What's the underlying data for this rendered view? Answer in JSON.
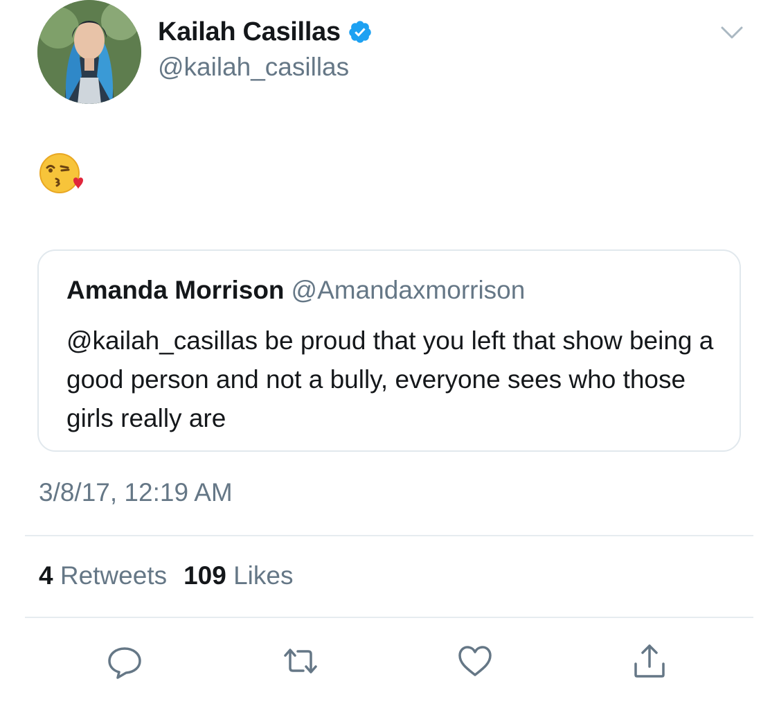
{
  "author": {
    "display_name": "Kailah Casillas",
    "handle": "@kailah_casillas",
    "verified": true
  },
  "tweet": {
    "emoji": "kissing-face-with-heart",
    "timestamp": "3/8/17, 12:19 AM"
  },
  "quoted_tweet": {
    "display_name": "Amanda Morrison",
    "handle": "@Amandaxmorrison",
    "text": "@kailah_casillas be proud that you left that show being a good person and not a bully, everyone sees who those girls really are"
  },
  "stats": {
    "retweets_count": "4",
    "retweets_label": "Retweets",
    "likes_count": "109",
    "likes_label": "Likes"
  },
  "actions": [
    "reply-icon",
    "retweet-icon",
    "like-icon",
    "share-icon"
  ],
  "colors": {
    "text_primary": "#14171a",
    "text_secondary": "#657786",
    "verified_blue": "#1da1f2",
    "border": "#e1e8ed"
  }
}
